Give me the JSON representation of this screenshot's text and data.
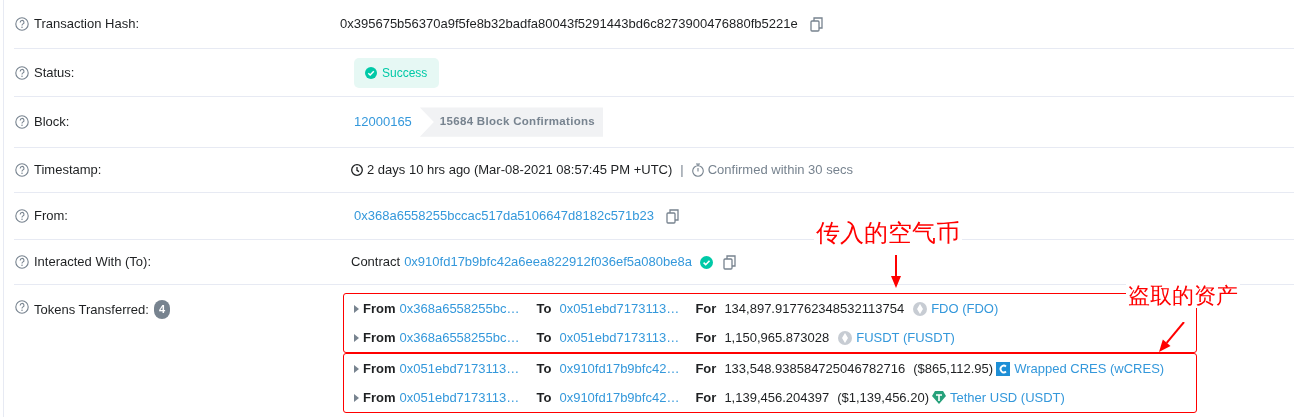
{
  "details": [
    {
      "kind": "hash",
      "label": "Transaction Hash:",
      "value": "0x395675b56370a9f5fe8b32badfa80043f5291443bd6c8273900476880fb5221e",
      "copyable": true
    },
    {
      "kind": "status",
      "label": "Status:",
      "value": "Success"
    },
    {
      "kind": "block",
      "label": "Block:",
      "value": "12000165",
      "confirmations": "15684 Block Confirmations"
    },
    {
      "kind": "timestamp",
      "label": "Timestamp:",
      "value": "2 days 10 hrs ago (Mar-08-2021 08:57:45 PM +UTC)",
      "separator": "|",
      "confirmed": "Confirmed within 30 secs"
    },
    {
      "kind": "address",
      "label": "From:",
      "value": "0x368a6558255bccac517da5106647d8182c571b23",
      "copyable": true
    },
    {
      "kind": "contract",
      "label": "Interacted With (To):",
      "prefix": "Contract",
      "value": "0x910fd17b9bfc42a6eea822912f036ef5a080be8a",
      "verified": true,
      "copyable": true
    },
    {
      "kind": "tokens",
      "label": "Tokens Transferred:",
      "count": "4",
      "groups": [
        {
          "highlighted": true,
          "transfers": [
            {
              "from_label": "From",
              "from": "0x368a6558255bc…",
              "to_label": "To",
              "to": "0x051ebd7173113…",
              "for_label": "For",
              "amount": "134,897.917762348532113754",
              "kind": "grey",
              "token": "FDO (FDO)"
            },
            {
              "from_label": "From",
              "from": "0x368a6558255bc…",
              "to_label": "To",
              "to": "0x051ebd7173113…",
              "for_label": "For",
              "amount": "1,150,965.873028",
              "kind": "grey",
              "token": "FUSDT (FUSDT)"
            }
          ]
        },
        {
          "highlighted": true,
          "transfers": [
            {
              "from_label": "From",
              "from": "0x051ebd7173113…",
              "to_label": "To",
              "to": "0x910fd17b9bfc42…",
              "for_label": "For",
              "amount": "133,548.938584725046782716",
              "usd": "($865,112.95)",
              "kind": "cres",
              "token": "Wrapped CRES (wCRES)"
            },
            {
              "from_label": "From",
              "from": "0x051ebd7173113…",
              "to_label": "To",
              "to": "0x910fd17b9bfc42…",
              "for_label": "For",
              "amount": "1,139,456.204397",
              "usd": "($1,139,456.20)",
              "kind": "tether",
              "token": "Tether USD (USDT)"
            }
          ]
        }
      ]
    }
  ],
  "annotations": [
    {
      "text": "传入的空气币"
    },
    {
      "text": "盗取的资产"
    }
  ]
}
